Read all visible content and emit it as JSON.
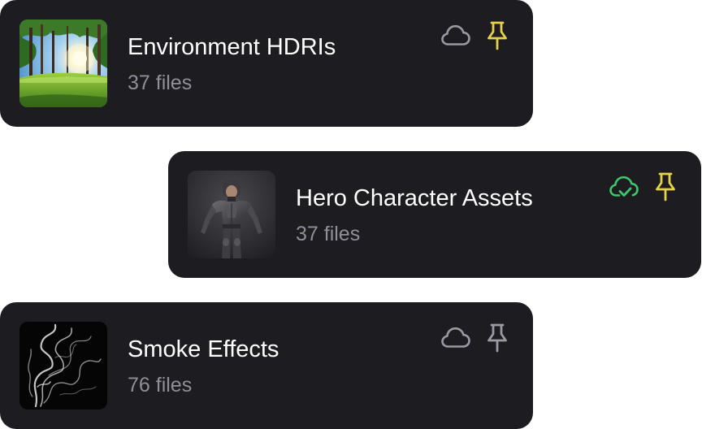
{
  "colors": {
    "card_background": "#1c1c21",
    "title_text": "#ffffff",
    "subtitle_text": "#8f8f9a",
    "pinned": "#e5d24a",
    "unpinned": "#9a9aa5",
    "cloud_default": "#9a9aa5",
    "cloud_synced": "#3fc66b"
  },
  "collections": [
    {
      "title": "Environment HDRIs",
      "file_count": "37 files",
      "thumbnail": "forest-sunlight",
      "cloud_icon": "cloud-icon",
      "cloud_synced": false,
      "pin_icon": "pin-icon",
      "pinned": true
    },
    {
      "title": "Hero Character Assets",
      "file_count": "37 files",
      "thumbnail": "armored-hero-character",
      "cloud_icon": "cloud-check-icon",
      "cloud_synced": true,
      "pin_icon": "pin-icon",
      "pinned": true
    },
    {
      "title": "Smoke Effects",
      "file_count": "76 files",
      "thumbnail": "white-smoke-on-black",
      "cloud_icon": "cloud-icon",
      "cloud_synced": false,
      "pin_icon": "pin-icon",
      "pinned": false
    }
  ]
}
